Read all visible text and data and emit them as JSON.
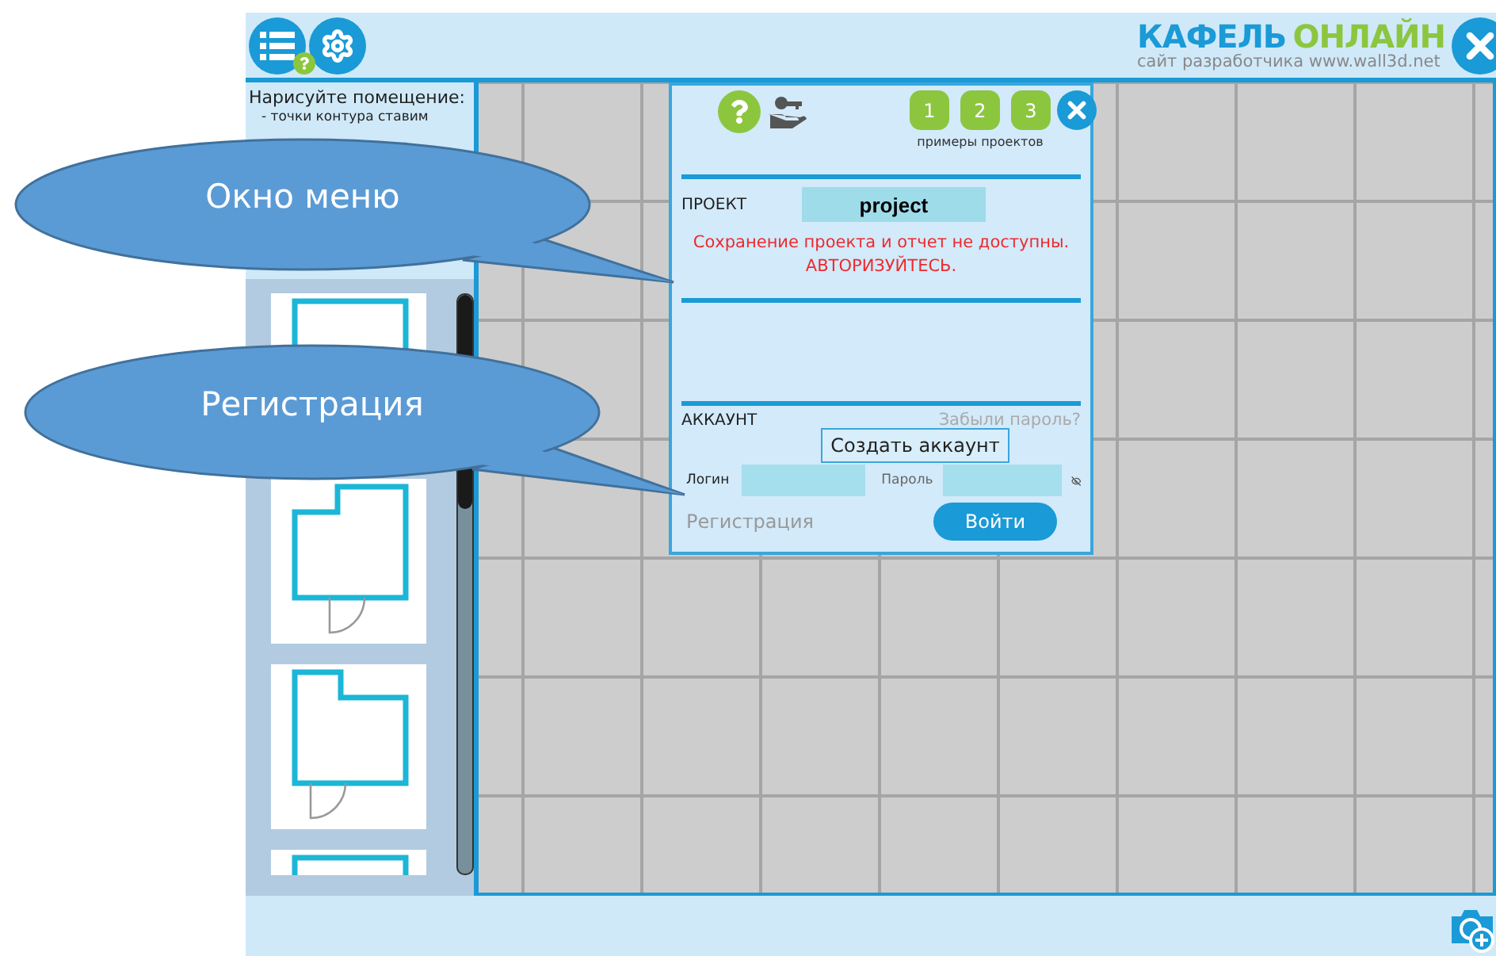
{
  "logo": {
    "brand_first": "КАФЕЛЬ",
    "brand_second": "ОНЛАЙН",
    "subtitle": "сайт разработчика www.wall3d.net"
  },
  "sidebar": {
    "instructions": [
      "Нарисуйте помещение:",
      "- точки контура ставим"
    ],
    "templates": [
      {
        "kind": "rect"
      },
      {
        "kind": "notch_left"
      },
      {
        "kind": "notch_right"
      },
      {
        "kind": "rect"
      }
    ]
  },
  "menu": {
    "examples": [
      "1",
      "2",
      "3"
    ],
    "examples_label": "примеры проектов",
    "project_label": "ПРОЕКТ",
    "project_name": "project",
    "warning": [
      "Сохранение проекта и отчет не доступны.",
      "АВТОРИЗУЙТЕСЬ."
    ],
    "account_label": "АККАУНТ",
    "forgot_password": "Забыли пароль?",
    "login_label": "Логин",
    "password_label": "Пароль",
    "tooltip": "Создать аккаунт",
    "register_link": "Регистрация",
    "login_button": "Войти"
  },
  "callouts": [
    {
      "text": "Окно меню"
    },
    {
      "text": "Регистрация"
    }
  ]
}
